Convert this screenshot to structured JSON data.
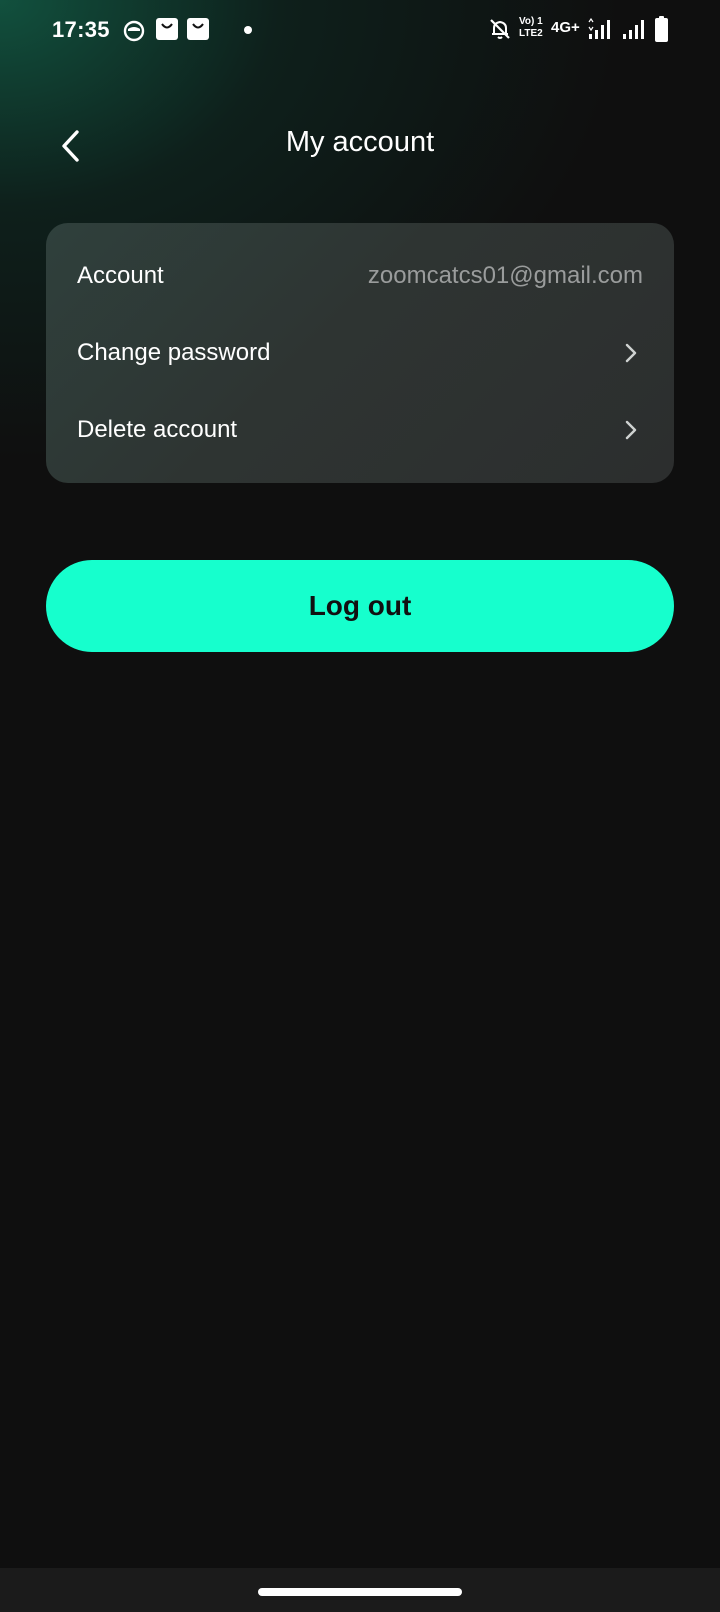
{
  "status_bar": {
    "time": "17:35",
    "network_label": "4G+",
    "volte_label": "Vo) 1",
    "lte_label": "LTE2",
    "icons": [
      "smiley-notification-icon",
      "shopping-bag-icon",
      "shopping-bag-icon",
      "dot-icon",
      "bell-off-icon",
      "signal-icon",
      "signal-icon",
      "battery-icon"
    ]
  },
  "header": {
    "title": "My account",
    "back_icon": "chevron-left-icon"
  },
  "account_card": {
    "rows": [
      {
        "label": "Account",
        "value": "zoomcatcs01@gmail.com"
      },
      {
        "label": "Change password",
        "icon": "chevron-right-icon"
      },
      {
        "label": "Delete account",
        "icon": "chevron-right-icon"
      }
    ]
  },
  "logout": {
    "label": "Log out"
  },
  "colors": {
    "background": "#0f0f0f",
    "accent": "#16ffcd",
    "card": "#2e3432",
    "muted_text": "#9a9c9c"
  }
}
